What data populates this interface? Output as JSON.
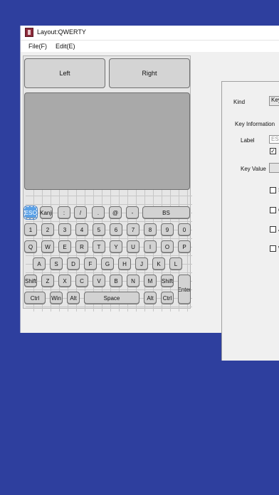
{
  "window": {
    "title": "Layout:QWERTY"
  },
  "menu": {
    "file": "File(F)",
    "edit": "Edit(E)"
  },
  "keyboard": {
    "left_label": "Left",
    "right_label": "Right",
    "rows": [
      [
        "ESC",
        "Kanji",
        ":",
        "/",
        ".",
        "@",
        "-",
        "BS"
      ],
      [
        "1",
        "2",
        "3",
        "4",
        "5",
        "6",
        "7",
        "8",
        "9",
        "0"
      ],
      [
        "Q",
        "W",
        "E",
        "R",
        "T",
        "Y",
        "U",
        "I",
        "O",
        "P"
      ],
      [
        "A",
        "S",
        "D",
        "F",
        "G",
        "H",
        "J",
        "K",
        "L"
      ],
      [
        "Shift",
        "Z",
        "X",
        "C",
        "V",
        "B",
        "N",
        "M",
        "Shift"
      ],
      [
        "Ctrl",
        "Win",
        "Alt",
        "Space",
        "Alt",
        "Ctrl"
      ]
    ],
    "enter_label": "Enter"
  },
  "panel": {
    "kind_label": "Kind",
    "kind_value": "Key",
    "group_label": "Key Information",
    "label_label": "Label",
    "label_value": "ESC",
    "checkbox_checked": true,
    "key_value_label": "Key Value",
    "checkbox_labels": [
      "S",
      "C",
      "A",
      "W"
    ]
  }
}
